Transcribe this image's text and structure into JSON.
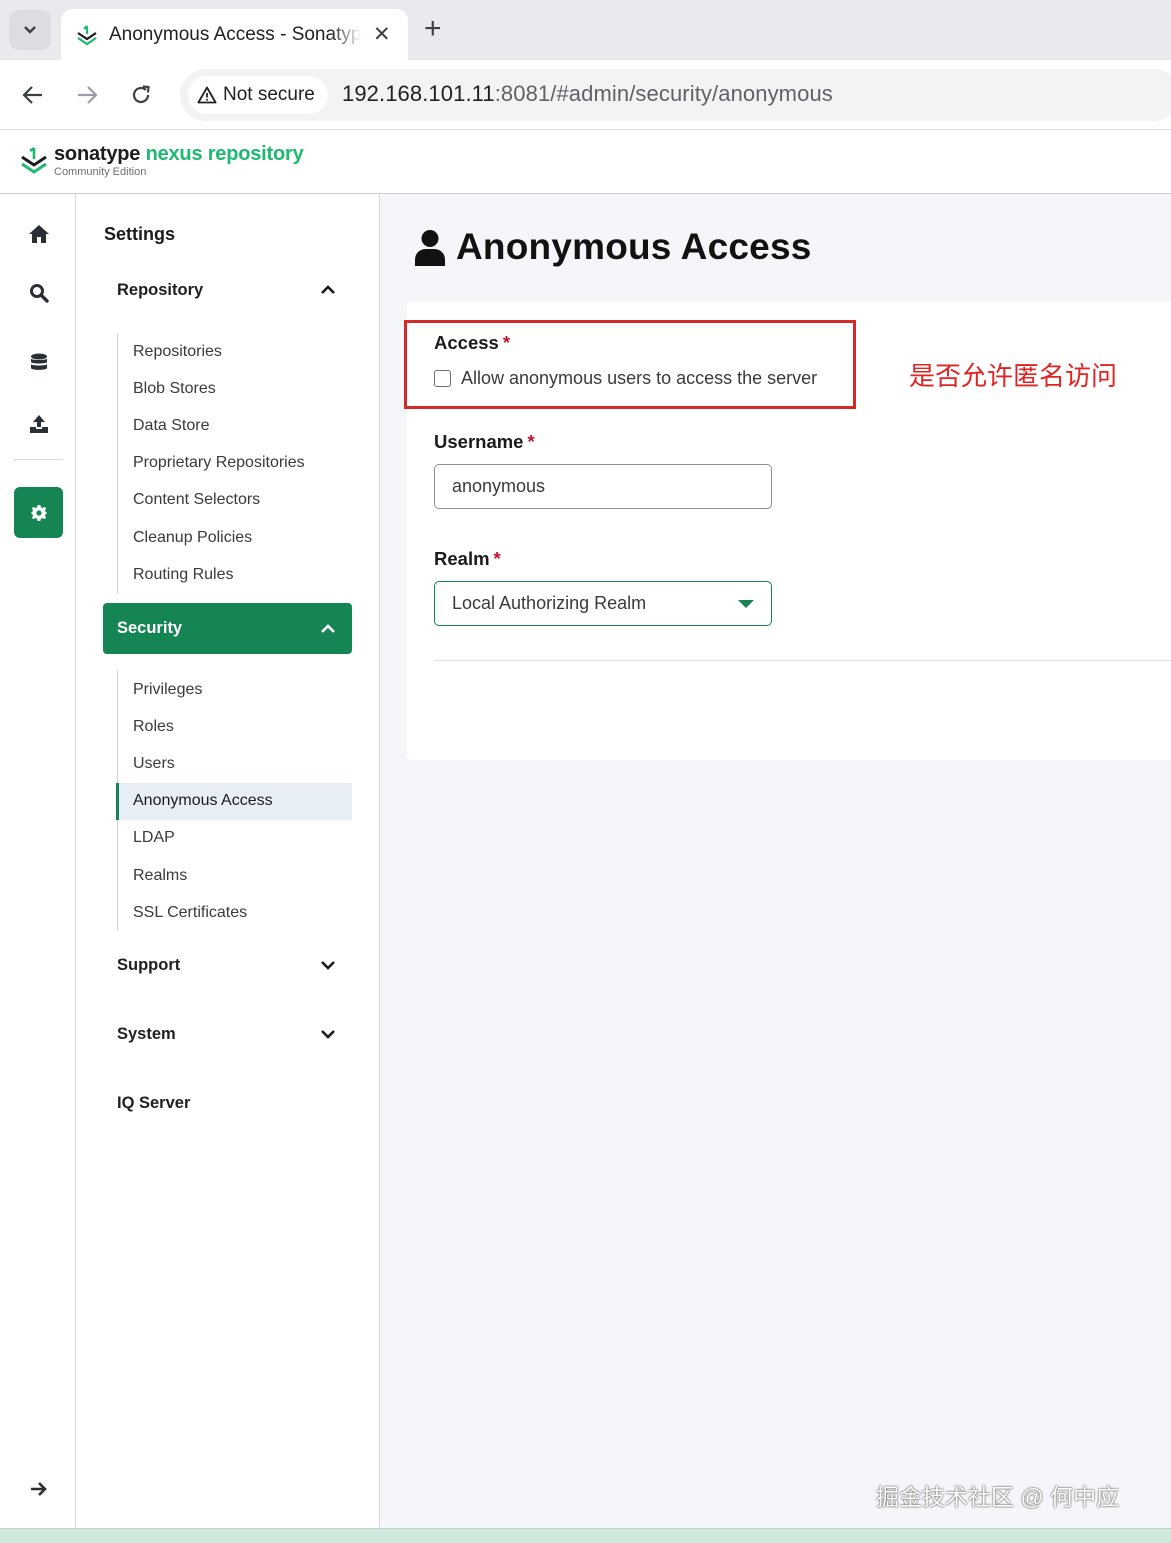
{
  "browser": {
    "tab_title": "Anonymous Access - Sonatype Nexus Repository",
    "security_chip": "Not secure",
    "url_host": "192.168.101.11",
    "url_rest": ":8081/#admin/security/anonymous"
  },
  "brand": {
    "name_a": "sonatype",
    "name_b": "nexus repository",
    "edition": "Community Edition",
    "color_green": "#1db970"
  },
  "rail": {
    "items": [
      "home-icon",
      "search-icon",
      "database-icon",
      "upload-icon",
      "gear-icon"
    ],
    "collapse": "arrow-right-icon",
    "active": "gear-icon"
  },
  "sidenav": {
    "title": "Settings",
    "repository": {
      "label": "Repository",
      "items": [
        "Repositories",
        "Blob Stores",
        "Data Store",
        "Proprietary Repositories",
        "Content Selectors",
        "Cleanup Policies",
        "Routing Rules"
      ]
    },
    "security": {
      "label": "Security",
      "items": [
        "Privileges",
        "Roles",
        "Users",
        "Anonymous Access",
        "LDAP",
        "Realms",
        "SSL Certificates"
      ],
      "selected": "Anonymous Access"
    },
    "support": "Support",
    "system": "System",
    "iq_server": "IQ Server"
  },
  "main": {
    "title": "Anonymous Access",
    "access_label": "Access",
    "access_checkbox_text": "Allow anonymous users to access the server",
    "access_checked": false,
    "username_label": "Username",
    "username_value": "anonymous",
    "realm_label": "Realm",
    "realm_value": "Local Authorizing Realm",
    "required_mark": "*",
    "accent_color": "#148553"
  },
  "annotation": "是否允许匿名访问",
  "watermark": "掘金技术社区 @ 何中应"
}
